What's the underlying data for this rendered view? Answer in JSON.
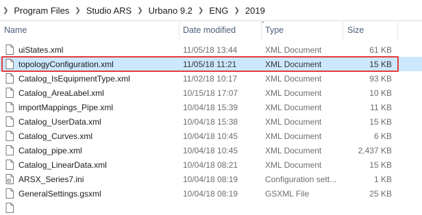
{
  "breadcrumb": {
    "lead_icon": "chevron-right-icon",
    "items": [
      "Program Files",
      "Studio ARS",
      "Urbano 9.2",
      "ENG",
      "2019"
    ]
  },
  "columns": {
    "name": "Name",
    "date": "Date modified",
    "type": "Type",
    "size": "Size"
  },
  "files": [
    {
      "name": "uiStates.xml",
      "date": "11/05/18 13:44",
      "type": "XML Document",
      "size": "61 KB",
      "icon": "xml-file-icon"
    },
    {
      "name": "topologyConfiguration.xml",
      "date": "11/05/18 11:21",
      "type": "XML Document",
      "size": "15 KB",
      "icon": "xml-file-icon",
      "selected": true
    },
    {
      "name": "Catalog_IsEquipmentType.xml",
      "date": "11/02/18 10:17",
      "type": "XML Document",
      "size": "93 KB",
      "icon": "xml-file-icon"
    },
    {
      "name": "Catalog_AreaLabel.xml",
      "date": "10/15/18 17:07",
      "type": "XML Document",
      "size": "10 KB",
      "icon": "xml-file-icon"
    },
    {
      "name": "importMappings_Pipe.xml",
      "date": "10/04/18 15:39",
      "type": "XML Document",
      "size": "11 KB",
      "icon": "xml-file-icon"
    },
    {
      "name": "Catalog_UserData.xml",
      "date": "10/04/18 15:38",
      "type": "XML Document",
      "size": "15 KB",
      "icon": "xml-file-icon"
    },
    {
      "name": "Catalog_Curves.xml",
      "date": "10/04/18 10:45",
      "type": "XML Document",
      "size": "6 KB",
      "icon": "xml-file-icon"
    },
    {
      "name": "Catalog_pipe.xml",
      "date": "10/04/18 10:45",
      "type": "XML Document",
      "size": "2,437 KB",
      "icon": "xml-file-icon"
    },
    {
      "name": "Catalog_LinearData.xml",
      "date": "10/04/18 08:21",
      "type": "XML Document",
      "size": "15 KB",
      "icon": "xml-file-icon"
    },
    {
      "name": "ARSX_Series7.ini",
      "date": "10/04/18 08:19",
      "type": "Configuration sett...",
      "size": "1 KB",
      "icon": "ini-file-icon"
    },
    {
      "name": "GeneralSettings.gsxml",
      "date": "10/04/18 08:19",
      "type": "GSXML File",
      "size": "25 KB",
      "icon": "generic-file-icon"
    },
    {
      "name": "",
      "date": "",
      "type": "",
      "size": "",
      "icon": "generic-file-icon"
    }
  ],
  "colors": {
    "selection": "#cce8ff",
    "highlight_border": "#e23b3b",
    "header_text": "#4c607a"
  }
}
